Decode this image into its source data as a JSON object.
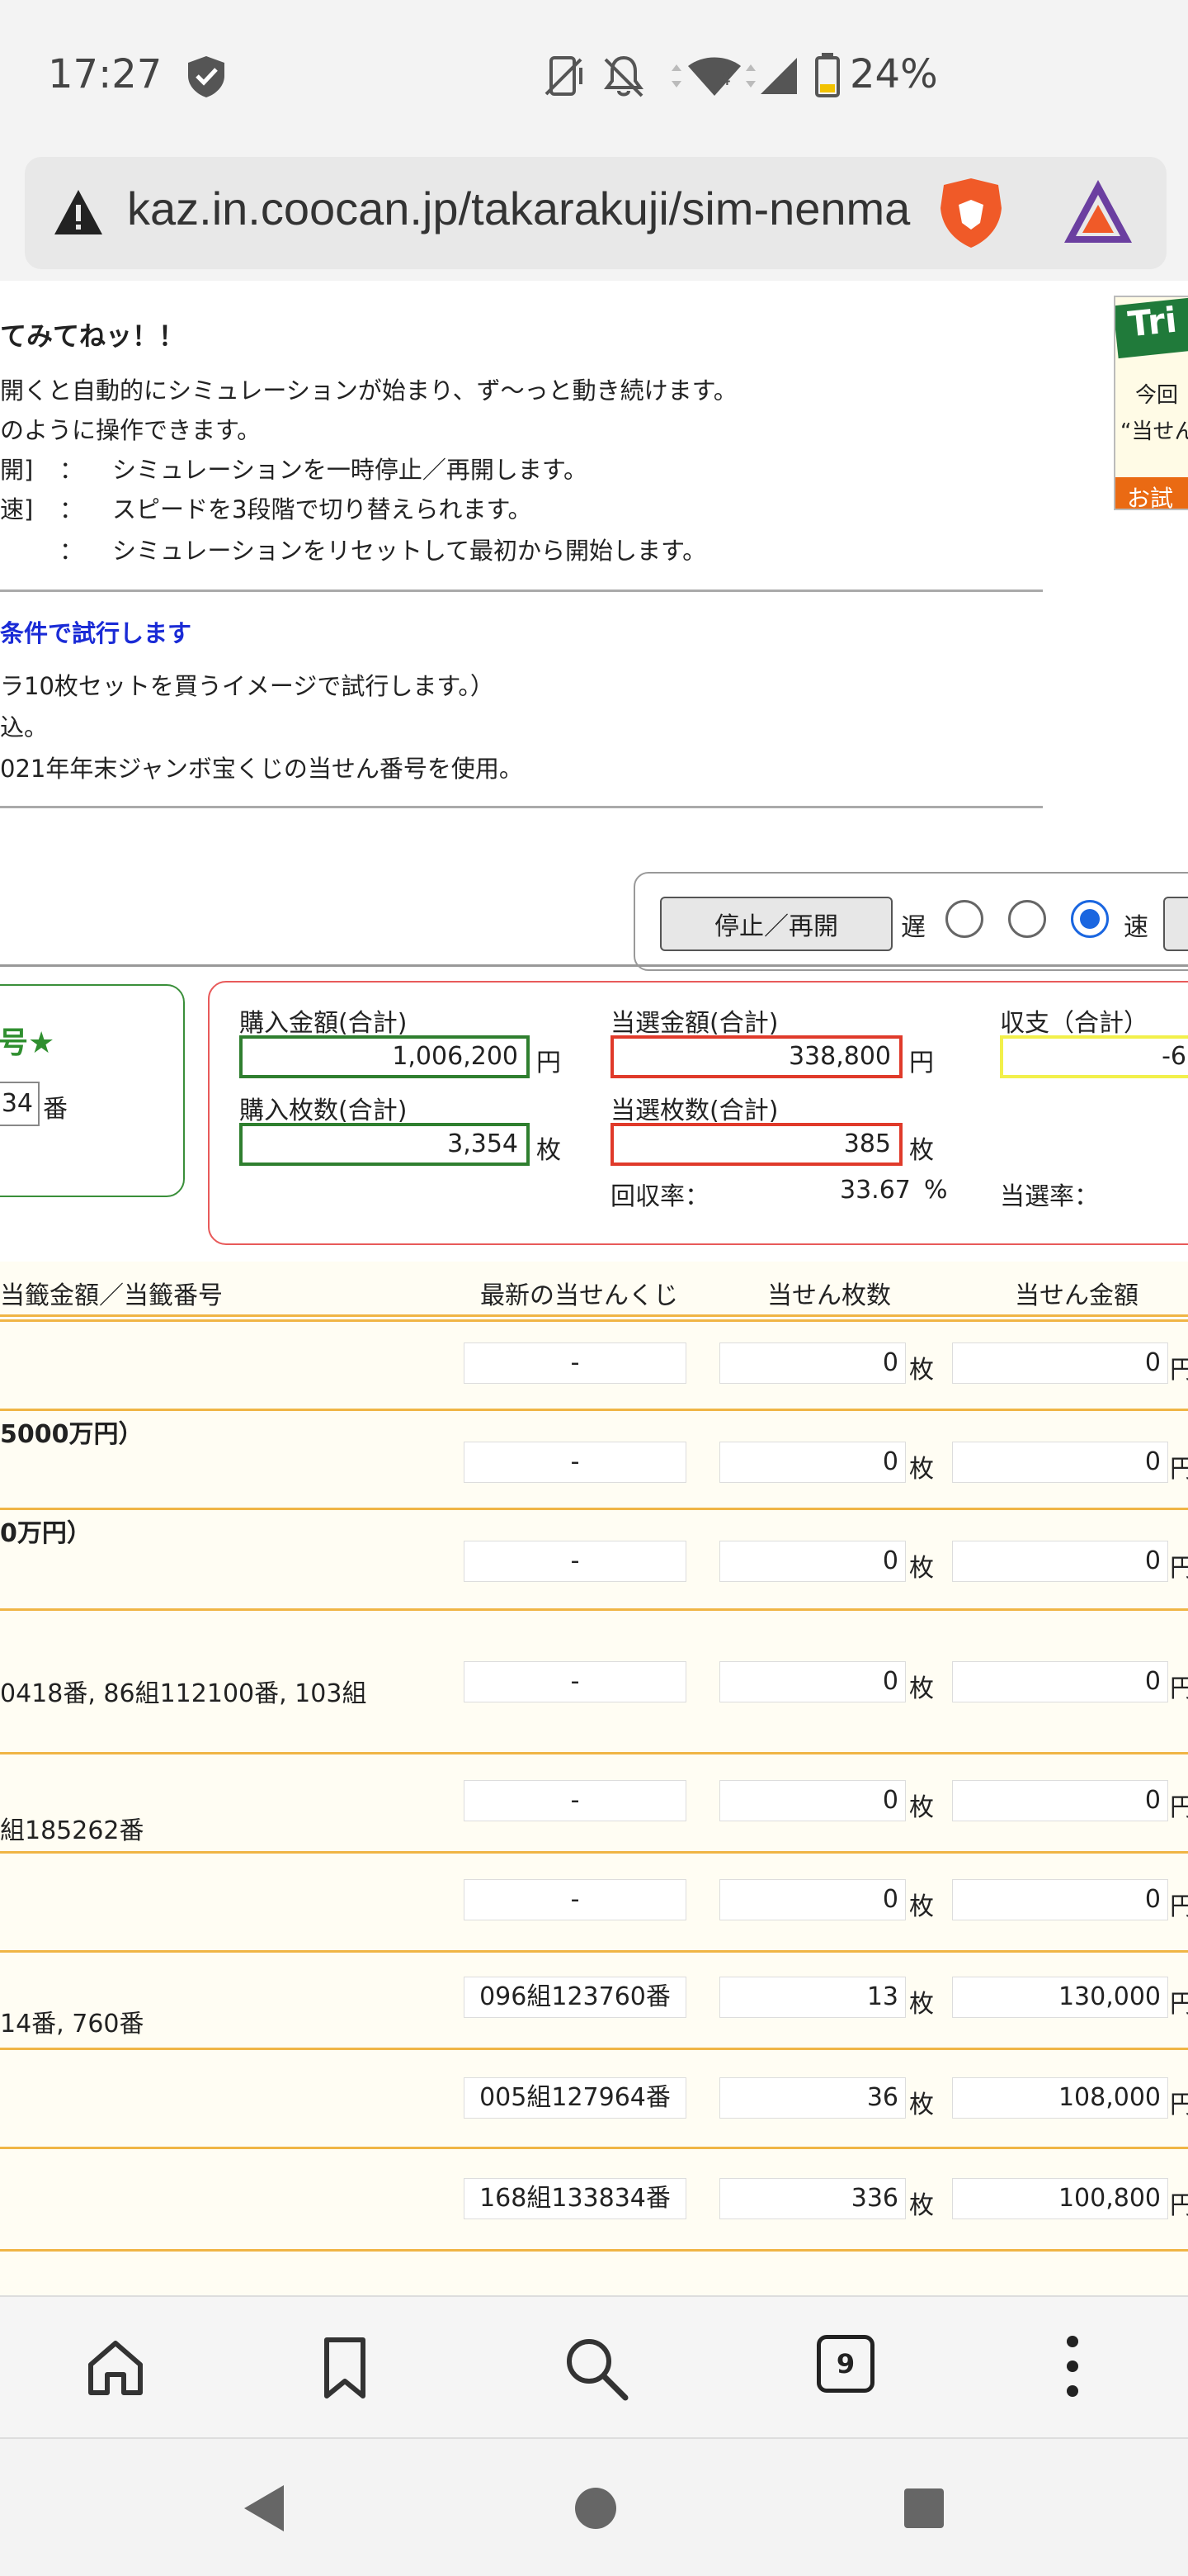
{
  "status": {
    "time": "17:27",
    "network_badge": "4",
    "battery": "24%"
  },
  "browser": {
    "url": "kaz.in.coocan.jp/takarakuji/sim-nenma",
    "tab_count": "9"
  },
  "intro": {
    "title": "てみてねッ！！",
    "line1": "開くと自動的にシミュレーションが始まり、ず〜っと動き続けます。",
    "line2": "のように操作できます。",
    "op1_key": "開]",
    "op1_sep": "：",
    "op1_desc": "シミュレーションを一時停止／再開します。",
    "op2_key": "速]",
    "op2_sep": "：",
    "op2_desc": "スピードを3段階で切り替えられます。",
    "op3_sep": "：",
    "op3_desc": "シミュレーションをリセットして最初から開始します。"
  },
  "conditions": {
    "heading": "条件で試行します",
    "line1": "ラ10枚セットを買うイメージで試行します。）",
    "line2": "込。",
    "line3": "021年年末ジャンボ宝くじの当せん番号を使用。"
  },
  "ad": {
    "banner": "Tri",
    "line1": "今回",
    "line2": "“当せん",
    "foot": "お試"
  },
  "controls": {
    "stop_label": "停止／再開",
    "slow_label": "遅",
    "fast_label": "速"
  },
  "left_panel": {
    "heading": "号★",
    "number_value": "34",
    "number_unit": "番"
  },
  "stats": {
    "purchase_amount_label": "購入金額(合計)",
    "purchase_amount_value": "1,006,200",
    "purchase_amount_unit": "円",
    "purchase_count_label": "購入枚数(合計)",
    "purchase_count_value": "3,354",
    "purchase_count_unit": "枚",
    "win_amount_label": "当選金額(合計)",
    "win_amount_value": "338,800",
    "win_amount_unit": "円",
    "win_count_label": "当選枚数(合計)",
    "win_count_value": "385",
    "win_count_unit": "枚",
    "recovery_label": "回収率：",
    "recovery_value": "33.67",
    "recovery_unit": "%",
    "balance_label": "収支（合計）",
    "balance_value": "-6",
    "win_rate_label": "当選率："
  },
  "table": {
    "headers": {
      "prize": "当籤金額／当籤番号",
      "latest": "最新の当せんくじ",
      "count": "当せん枚数",
      "amount": "当せん金額"
    },
    "count_unit": "枚",
    "amount_unit": "円",
    "rows": [
      {
        "prize": "",
        "latest": "-",
        "count": "0",
        "amount": "0"
      },
      {
        "prize": "5000万円）",
        "latest": "-",
        "count": "0",
        "amount": "0"
      },
      {
        "prize": "0万円）",
        "latest": "-",
        "count": "0",
        "amount": "0"
      },
      {
        "prize": "0418番, 86組112100番, 103組",
        "latest": "-",
        "count": "0",
        "amount": "0"
      },
      {
        "prize": "組185262番",
        "latest": "-",
        "count": "0",
        "amount": "0"
      },
      {
        "prize": "",
        "latest": "-",
        "count": "0",
        "amount": "0"
      },
      {
        "prize": "14番, 760番",
        "latest": "096組123760番",
        "count": "13",
        "amount": "130,000"
      },
      {
        "prize": "",
        "latest": "005組127964番",
        "count": "36",
        "amount": "108,000"
      },
      {
        "prize": "",
        "latest": "168組133834番",
        "count": "336",
        "amount": "100,800"
      }
    ]
  }
}
